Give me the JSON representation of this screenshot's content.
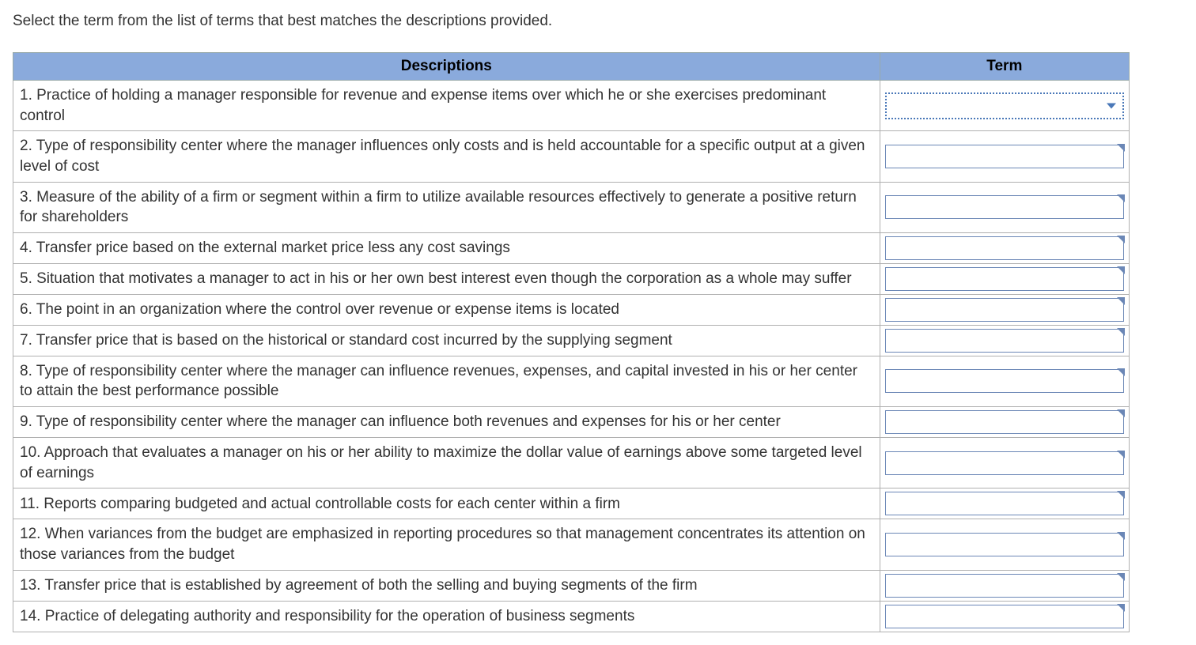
{
  "instruction": "Select the term from the list of terms that best matches the descriptions provided.",
  "headers": {
    "descriptions": "Descriptions",
    "term": "Term"
  },
  "rows": [
    {
      "num": "1",
      "desc": "1. Practice of holding a manager responsible for revenue and expense items over which he or she exercises predominant control",
      "term": "",
      "style": "dropdown-active"
    },
    {
      "num": "2",
      "desc": "2. Type of responsibility center where the manager influences only costs and is held accountable for a specific output at a given level of cost",
      "term": "",
      "style": "standard"
    },
    {
      "num": "3",
      "desc": "3. Measure of the ability of a firm or segment within a firm to utilize available resources effectively to generate a positive return for shareholders",
      "term": "",
      "style": "standard"
    },
    {
      "num": "4",
      "desc": "4. Transfer price based on the external market price less any cost savings",
      "term": "",
      "style": "standard"
    },
    {
      "num": "5",
      "desc": "5. Situation that motivates a manager to act in his or her own best interest even though the corporation as a whole may suffer",
      "term": "",
      "style": "standard"
    },
    {
      "num": "6",
      "desc": "6. The point in an organization where the control over revenue or expense items is located",
      "term": "",
      "style": "standard"
    },
    {
      "num": "7",
      "desc": "7. Transfer price that is based on the historical or standard cost incurred by the supplying segment",
      "term": "",
      "style": "standard"
    },
    {
      "num": "8",
      "desc": "8. Type of responsibility center where the manager can influence revenues, expenses, and capital invested in his or her center to attain the best performance possible",
      "term": "",
      "style": "standard"
    },
    {
      "num": "9",
      "desc": "9. Type of responsibility center where the manager can influence both revenues and expenses for his or her center",
      "term": "",
      "style": "standard"
    },
    {
      "num": "10",
      "desc": "10. Approach that evaluates a manager on his or her ability to maximize the dollar value of earnings above some targeted level of earnings",
      "term": "",
      "style": "standard"
    },
    {
      "num": "11",
      "desc": "11. Reports comparing budgeted and actual controllable costs for each center within a firm",
      "term": "",
      "style": "standard"
    },
    {
      "num": "12",
      "desc": "12. When variances from the budget are emphasized in reporting procedures so that management concentrates its attention on those variances from the budget",
      "term": "",
      "style": "standard"
    },
    {
      "num": "13",
      "desc": "13. Transfer price that is established by agreement of both the selling and buying segments of the firm",
      "term": "",
      "style": "standard"
    },
    {
      "num": "14",
      "desc": "14. Practice of delegating authority and responsibility for the operation of business segments",
      "term": "",
      "style": "standard"
    }
  ]
}
